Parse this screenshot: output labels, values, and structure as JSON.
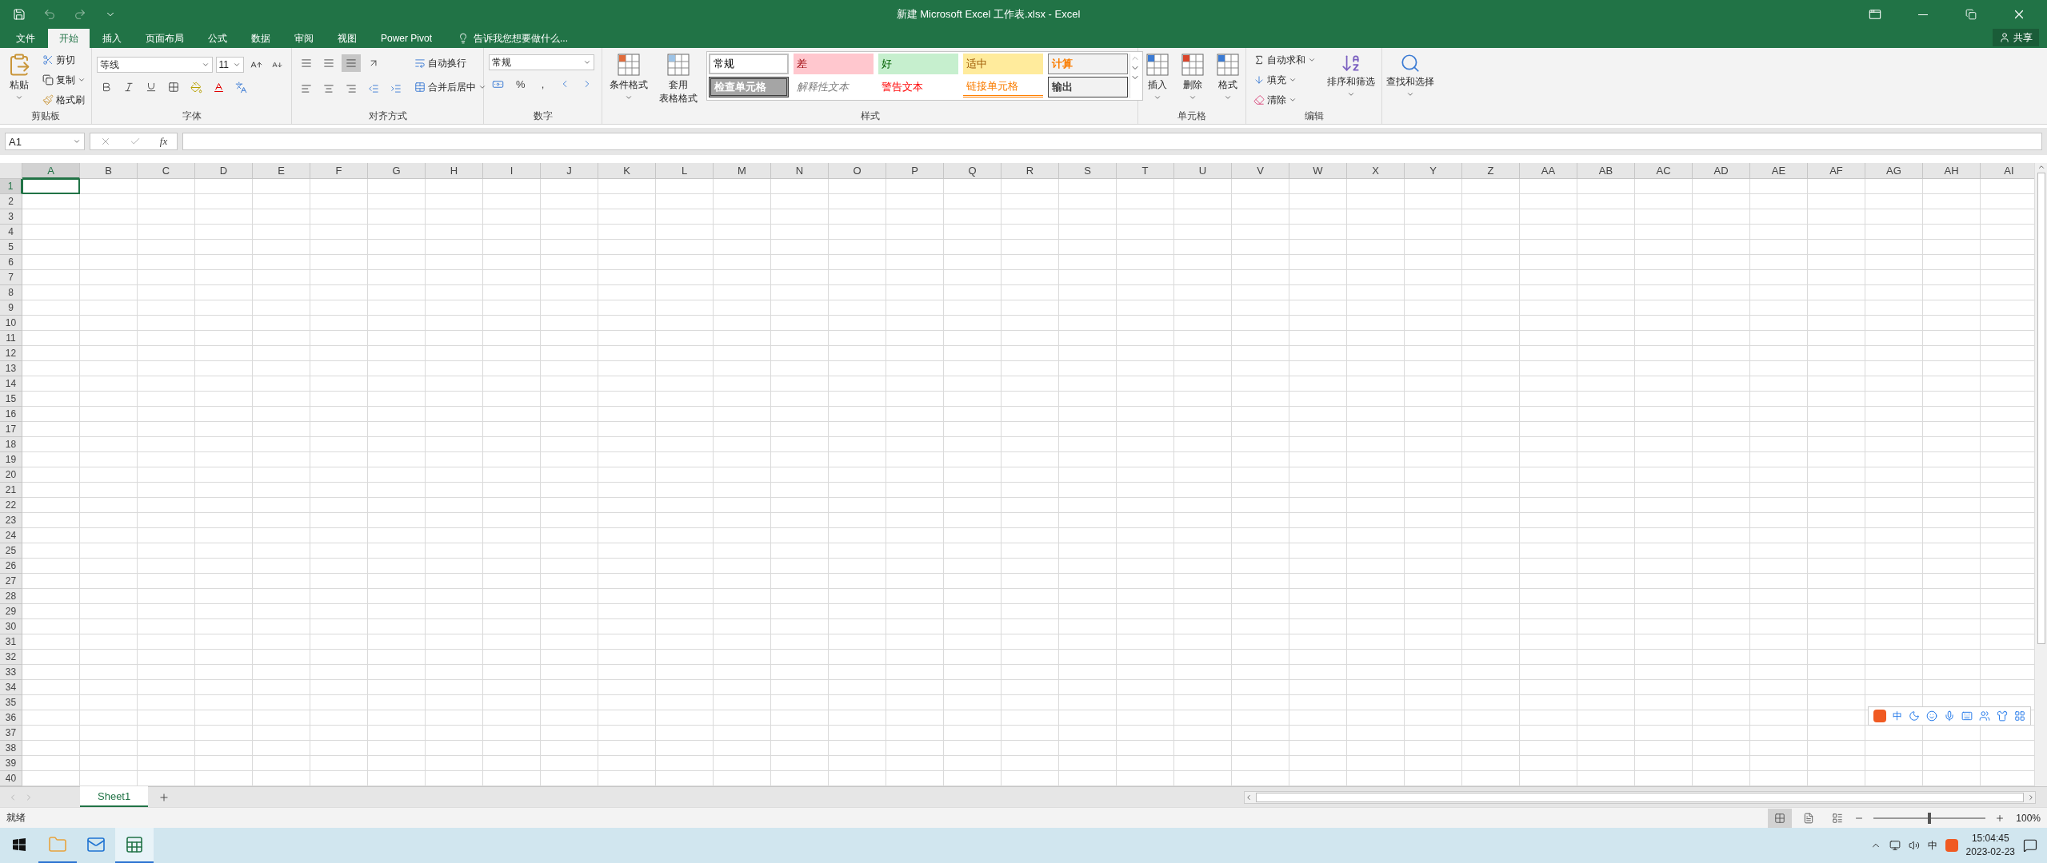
{
  "title_bar": {
    "title": "新建 Microsoft Excel 工作表.xlsx - Excel",
    "share": "共享"
  },
  "tabs": [
    {
      "label": "文件",
      "selected": false
    },
    {
      "label": "开始",
      "selected": true
    },
    {
      "label": "插入",
      "selected": false
    },
    {
      "label": "页面布局",
      "selected": false
    },
    {
      "label": "公式",
      "selected": false
    },
    {
      "label": "数据",
      "selected": false
    },
    {
      "label": "审阅",
      "selected": false
    },
    {
      "label": "视图",
      "selected": false
    },
    {
      "label": "Power Pivot",
      "selected": false
    }
  ],
  "tell_me": {
    "placeholder": "告诉我您想要做什么..."
  },
  "ribbon": {
    "clipboard": {
      "label": "剪贴板",
      "paste": "粘贴",
      "cut": "剪切",
      "copy": "复制",
      "format_painter": "格式刷"
    },
    "font": {
      "label": "字体",
      "font_name": "等线",
      "font_size": "11"
    },
    "alignment": {
      "label": "对齐方式",
      "wrap_text": "自动换行",
      "merge": "合并后居中"
    },
    "number": {
      "label": "数字",
      "format": "常规",
      "percent": "%",
      "comma": ","
    },
    "styles": {
      "label": "样式",
      "conditional": "条件格式",
      "format_table": [
        "套用",
        "表格格式"
      ],
      "cell_styles": [
        {
          "label": "常规",
          "kind": "normal"
        },
        {
          "label": "差",
          "kind": "bad"
        },
        {
          "label": "好",
          "kind": "good"
        },
        {
          "label": "适中",
          "kind": "neutral"
        },
        {
          "label": "计算",
          "kind": "calculation"
        },
        {
          "label": "检查单元格",
          "kind": "check"
        },
        {
          "label": "解释性文本",
          "kind": "explanatory"
        },
        {
          "label": "警告文本",
          "kind": "warning"
        },
        {
          "label": "链接单元格",
          "kind": "linked"
        },
        {
          "label": "输出",
          "kind": "output"
        }
      ]
    },
    "cells": {
      "label": "单元格",
      "buttons": [
        {
          "kind": "insert",
          "label": "插入"
        },
        {
          "kind": "delete",
          "label": "删除"
        },
        {
          "kind": "format",
          "label": "格式"
        }
      ]
    },
    "editing": {
      "label": "编辑",
      "autosum": "自动求和",
      "fill": "填充",
      "clear": "清除",
      "sort": "排序和筛选",
      "find": "查找和选择"
    }
  },
  "formula_bar": {
    "name_box": "A1",
    "fx": "fx"
  },
  "sheet": {
    "columns": [
      {
        "label": "A",
        "selected": true
      },
      {
        "label": "B",
        "selected": false
      },
      {
        "label": "C",
        "selected": false
      },
      {
        "label": "D",
        "selected": false
      },
      {
        "label": "E",
        "selected": false
      },
      {
        "label": "F",
        "selected": false
      },
      {
        "label": "G",
        "selected": false
      },
      {
        "label": "H",
        "selected": false
      },
      {
        "label": "I",
        "selected": false
      },
      {
        "label": "J",
        "selected": false
      },
      {
        "label": "K",
        "selected": false
      },
      {
        "label": "L",
        "selected": false
      },
      {
        "label": "M",
        "selected": false
      },
      {
        "label": "N",
        "selected": false
      },
      {
        "label": "O",
        "selected": false
      },
      {
        "label": "P",
        "selected": false
      },
      {
        "label": "Q",
        "selected": false
      },
      {
        "label": "R",
        "selected": false
      },
      {
        "label": "S",
        "selected": false
      },
      {
        "label": "T",
        "selected": false
      },
      {
        "label": "U",
        "selected": false
      },
      {
        "label": "V",
        "selected": false
      },
      {
        "label": "W",
        "selected": false
      },
      {
        "label": "X",
        "selected": false
      },
      {
        "label": "Y",
        "selected": false
      },
      {
        "label": "Z",
        "selected": false
      },
      {
        "label": "AA",
        "selected": false
      },
      {
        "label": "AB",
        "selected": false
      },
      {
        "label": "AC",
        "selected": false
      },
      {
        "label": "AD",
        "selected": false
      },
      {
        "label": "AE",
        "selected": false
      },
      {
        "label": "AF",
        "selected": false
      },
      {
        "label": "AG",
        "selected": false
      },
      {
        "label": "AH",
        "selected": false
      },
      {
        "label": "AI",
        "selected": false
      }
    ],
    "rows": [
      {
        "label": "1",
        "selected": true
      },
      {
        "label": "2",
        "selected": false
      },
      {
        "label": "3",
        "selected": false
      },
      {
        "label": "4",
        "selected": false
      },
      {
        "label": "5",
        "selected": false
      },
      {
        "label": "6",
        "selected": false
      },
      {
        "label": "7",
        "selected": false
      },
      {
        "label": "8",
        "selected": false
      },
      {
        "label": "9",
        "selected": false
      },
      {
        "label": "10",
        "selected": false
      },
      {
        "label": "11",
        "selected": false
      },
      {
        "label": "12",
        "selected": false
      },
      {
        "label": "13",
        "selected": false
      },
      {
        "label": "14",
        "selected": false
      },
      {
        "label": "15",
        "selected": false
      },
      {
        "label": "16",
        "selected": false
      },
      {
        "label": "17",
        "selected": false
      },
      {
        "label": "18",
        "selected": false
      },
      {
        "label": "19",
        "selected": false
      },
      {
        "label": "20",
        "selected": false
      },
      {
        "label": "21",
        "selected": false
      },
      {
        "label": "22",
        "selected": false
      },
      {
        "label": "23",
        "selected": false
      },
      {
        "label": "24",
        "selected": false
      },
      {
        "label": "25",
        "selected": false
      },
      {
        "label": "26",
        "selected": false
      },
      {
        "label": "27",
        "selected": false
      },
      {
        "label": "28",
        "selected": false
      },
      {
        "label": "29",
        "selected": false
      },
      {
        "label": "30",
        "selected": false
      },
      {
        "label": "31",
        "selected": false
      },
      {
        "label": "32",
        "selected": false
      },
      {
        "label": "33",
        "selected": false
      },
      {
        "label": "34",
        "selected": false
      },
      {
        "label": "35",
        "selected": false
      },
      {
        "label": "36",
        "selected": false
      },
      {
        "label": "37",
        "selected": false
      },
      {
        "label": "38",
        "selected": false
      },
      {
        "label": "39",
        "selected": false
      },
      {
        "label": "40",
        "selected": false
      }
    ]
  },
  "ime_toolbar": {
    "mode": "中"
  },
  "sheet_tabs": [
    {
      "label": "Sheet1",
      "selected": true
    }
  ],
  "status_bar": {
    "status": "就绪",
    "views": [
      {
        "kind": "normal",
        "selected": true
      },
      {
        "kind": "page_layout",
        "selected": false
      },
      {
        "kind": "page_break",
        "selected": false
      }
    ],
    "zoom": {
      "level": 0.5,
      "reading": "100%"
    }
  },
  "taskbar": {
    "apps": [
      {
        "kind": "explorer",
        "running": true,
        "active": false
      },
      {
        "kind": "mail",
        "running": false,
        "active": false
      },
      {
        "kind": "excel",
        "running": true,
        "active": true
      }
    ],
    "ime": "中",
    "time": "15:04:45",
    "date": "2023-02-23"
  }
}
